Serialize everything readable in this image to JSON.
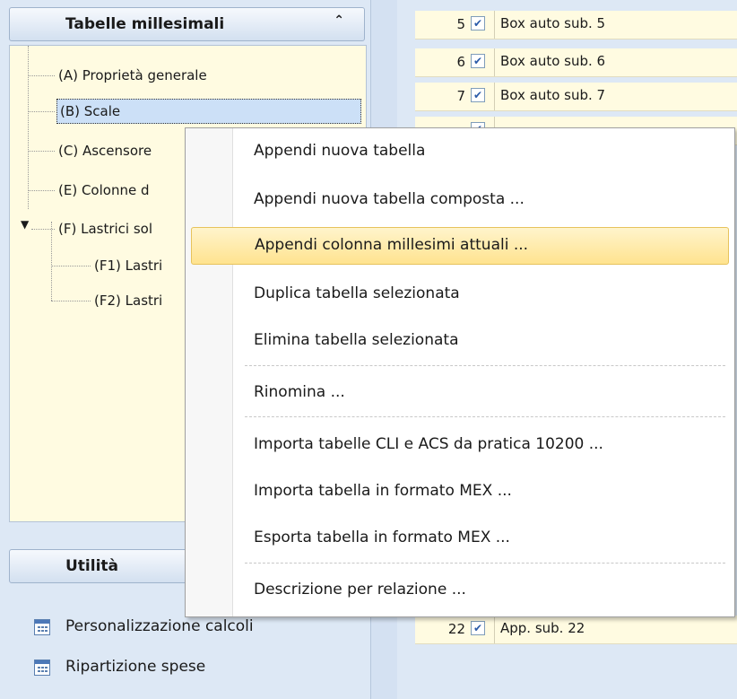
{
  "left_panel": {
    "title": "Tabelle millesimali",
    "collapse_icon": "chevron-up-icon",
    "tree": [
      {
        "label": "(A) Proprietà generale"
      },
      {
        "label": "(B) Scale",
        "selected": true
      },
      {
        "label": "(C) Ascensore"
      },
      {
        "label": "(E) Colonne d"
      },
      {
        "label": "(F) Lastrici sol",
        "expanded": true
      },
      {
        "label": "(F1) Lastri"
      },
      {
        "label": "(F2) Lastri"
      }
    ]
  },
  "utility_panel": {
    "title": "Utilità",
    "items": [
      {
        "label": "Personalizzazione calcoli",
        "icon": "calculator-icon"
      },
      {
        "label": "Ripartizione spese",
        "icon": "calculator-icon"
      }
    ]
  },
  "grid": {
    "rows": [
      {
        "num": "5",
        "checked": true,
        "label": "Box auto sub. 5"
      },
      {
        "num": "6",
        "checked": true,
        "label": "Box auto sub. 6"
      },
      {
        "num": "7",
        "checked": true,
        "label": "Box auto sub. 7"
      },
      {
        "num": "22",
        "checked": true,
        "label": "App. sub. 22"
      }
    ]
  },
  "context_menu": {
    "items": [
      "Appendi nuova tabella",
      "Appendi nuova tabella composta ...",
      "Appendi colonna millesimi attuali ...",
      "Duplica tabella selezionata",
      "Elimina tabella selezionata",
      "Rinomina ...",
      "Importa tabelle CLI e ACS da pratica 10200 ...",
      "Importa tabella in formato MEX ...",
      "Esporta tabella in formato MEX ...",
      "Descrizione per relazione ..."
    ],
    "highlighted_index": 2
  }
}
